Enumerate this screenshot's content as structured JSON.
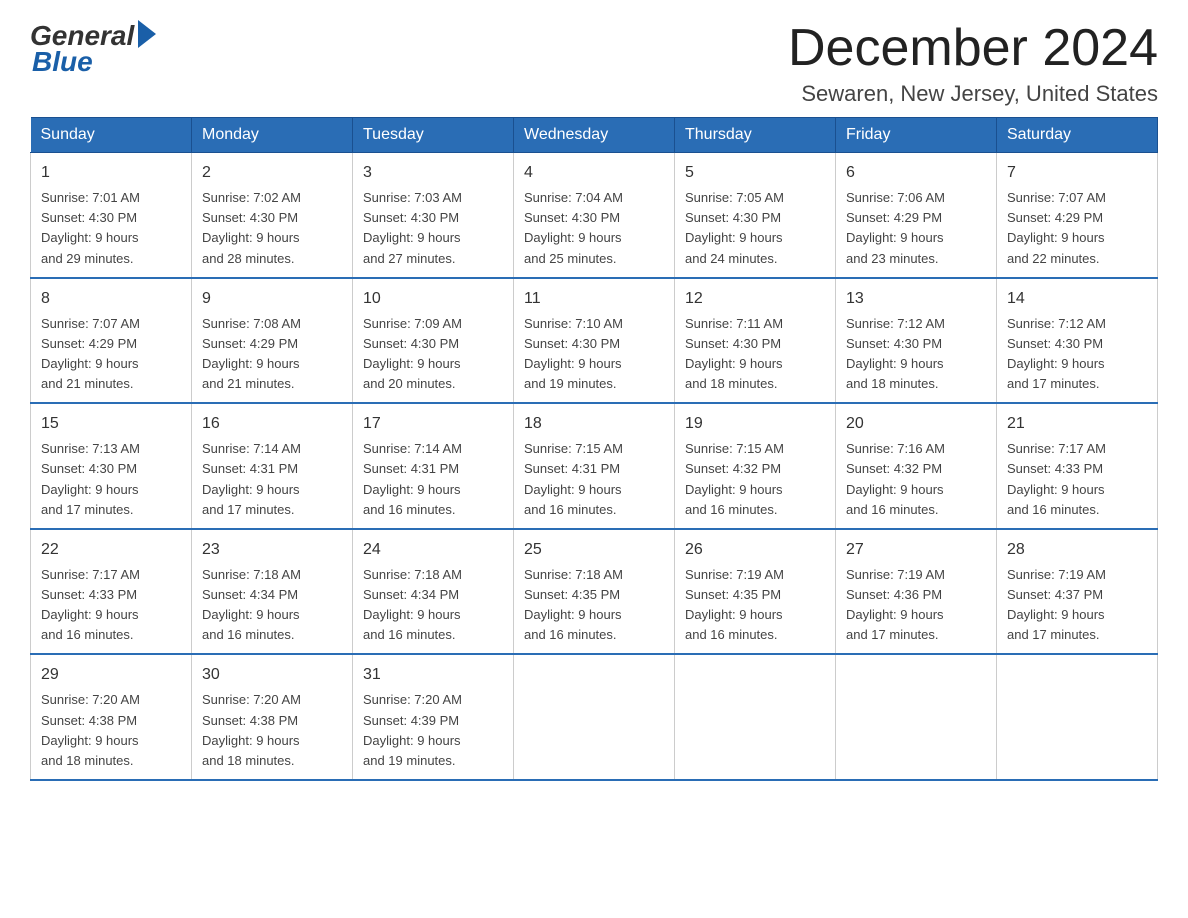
{
  "logo": {
    "general": "General",
    "blue": "Blue"
  },
  "title": "December 2024",
  "location": "Sewaren, New Jersey, United States",
  "weekdays": [
    "Sunday",
    "Monday",
    "Tuesday",
    "Wednesday",
    "Thursday",
    "Friday",
    "Saturday"
  ],
  "weeks": [
    [
      {
        "day": "1",
        "sunrise": "7:01 AM",
        "sunset": "4:30 PM",
        "daylight": "9 hours and 29 minutes."
      },
      {
        "day": "2",
        "sunrise": "7:02 AM",
        "sunset": "4:30 PM",
        "daylight": "9 hours and 28 minutes."
      },
      {
        "day": "3",
        "sunrise": "7:03 AM",
        "sunset": "4:30 PM",
        "daylight": "9 hours and 27 minutes."
      },
      {
        "day": "4",
        "sunrise": "7:04 AM",
        "sunset": "4:30 PM",
        "daylight": "9 hours and 25 minutes."
      },
      {
        "day": "5",
        "sunrise": "7:05 AM",
        "sunset": "4:30 PM",
        "daylight": "9 hours and 24 minutes."
      },
      {
        "day": "6",
        "sunrise": "7:06 AM",
        "sunset": "4:29 PM",
        "daylight": "9 hours and 23 minutes."
      },
      {
        "day": "7",
        "sunrise": "7:07 AM",
        "sunset": "4:29 PM",
        "daylight": "9 hours and 22 minutes."
      }
    ],
    [
      {
        "day": "8",
        "sunrise": "7:07 AM",
        "sunset": "4:29 PM",
        "daylight": "9 hours and 21 minutes."
      },
      {
        "day": "9",
        "sunrise": "7:08 AM",
        "sunset": "4:29 PM",
        "daylight": "9 hours and 21 minutes."
      },
      {
        "day": "10",
        "sunrise": "7:09 AM",
        "sunset": "4:30 PM",
        "daylight": "9 hours and 20 minutes."
      },
      {
        "day": "11",
        "sunrise": "7:10 AM",
        "sunset": "4:30 PM",
        "daylight": "9 hours and 19 minutes."
      },
      {
        "day": "12",
        "sunrise": "7:11 AM",
        "sunset": "4:30 PM",
        "daylight": "9 hours and 18 minutes."
      },
      {
        "day": "13",
        "sunrise": "7:12 AM",
        "sunset": "4:30 PM",
        "daylight": "9 hours and 18 minutes."
      },
      {
        "day": "14",
        "sunrise": "7:12 AM",
        "sunset": "4:30 PM",
        "daylight": "9 hours and 17 minutes."
      }
    ],
    [
      {
        "day": "15",
        "sunrise": "7:13 AM",
        "sunset": "4:30 PM",
        "daylight": "9 hours and 17 minutes."
      },
      {
        "day": "16",
        "sunrise": "7:14 AM",
        "sunset": "4:31 PM",
        "daylight": "9 hours and 17 minutes."
      },
      {
        "day": "17",
        "sunrise": "7:14 AM",
        "sunset": "4:31 PM",
        "daylight": "9 hours and 16 minutes."
      },
      {
        "day": "18",
        "sunrise": "7:15 AM",
        "sunset": "4:31 PM",
        "daylight": "9 hours and 16 minutes."
      },
      {
        "day": "19",
        "sunrise": "7:15 AM",
        "sunset": "4:32 PM",
        "daylight": "9 hours and 16 minutes."
      },
      {
        "day": "20",
        "sunrise": "7:16 AM",
        "sunset": "4:32 PM",
        "daylight": "9 hours and 16 minutes."
      },
      {
        "day": "21",
        "sunrise": "7:17 AM",
        "sunset": "4:33 PM",
        "daylight": "9 hours and 16 minutes."
      }
    ],
    [
      {
        "day": "22",
        "sunrise": "7:17 AM",
        "sunset": "4:33 PM",
        "daylight": "9 hours and 16 minutes."
      },
      {
        "day": "23",
        "sunrise": "7:18 AM",
        "sunset": "4:34 PM",
        "daylight": "9 hours and 16 minutes."
      },
      {
        "day": "24",
        "sunrise": "7:18 AM",
        "sunset": "4:34 PM",
        "daylight": "9 hours and 16 minutes."
      },
      {
        "day": "25",
        "sunrise": "7:18 AM",
        "sunset": "4:35 PM",
        "daylight": "9 hours and 16 minutes."
      },
      {
        "day": "26",
        "sunrise": "7:19 AM",
        "sunset": "4:35 PM",
        "daylight": "9 hours and 16 minutes."
      },
      {
        "day": "27",
        "sunrise": "7:19 AM",
        "sunset": "4:36 PM",
        "daylight": "9 hours and 17 minutes."
      },
      {
        "day": "28",
        "sunrise": "7:19 AM",
        "sunset": "4:37 PM",
        "daylight": "9 hours and 17 minutes."
      }
    ],
    [
      {
        "day": "29",
        "sunrise": "7:20 AM",
        "sunset": "4:38 PM",
        "daylight": "9 hours and 18 minutes."
      },
      {
        "day": "30",
        "sunrise": "7:20 AM",
        "sunset": "4:38 PM",
        "daylight": "9 hours and 18 minutes."
      },
      {
        "day": "31",
        "sunrise": "7:20 AM",
        "sunset": "4:39 PM",
        "daylight": "9 hours and 19 minutes."
      },
      null,
      null,
      null,
      null
    ]
  ]
}
